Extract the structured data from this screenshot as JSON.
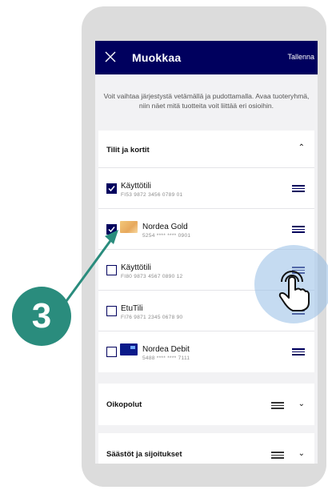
{
  "header": {
    "title": "Muokkaa",
    "save_label": "Tallenna",
    "close_icon": "close-icon"
  },
  "intro_text": "Voit vaihtaa järjestystä vetämällä ja pudottamalla. Avaa tuoteryhmä, niin näet mitä tuotteita voit liittää eri osioihin.",
  "sections": {
    "accounts": {
      "title": "Tilit ja kortit",
      "expanded": true
    },
    "shortcuts": {
      "title": "Oikopolut"
    },
    "savings": {
      "title": "Säästöt ja sijoitukset"
    }
  },
  "items": [
    {
      "name": "Käyttötili",
      "number": "FI53 9872 3456 0789 01",
      "checked": true,
      "thumb": "none"
    },
    {
      "name": "Nordea Gold",
      "number": "5254 **** **** 0901",
      "checked": true,
      "thumb": "gold-card"
    },
    {
      "name": "Käyttötili",
      "number": "FI80 9873 4567 0890 12",
      "checked": false,
      "thumb": "none"
    },
    {
      "name": "EtuTili",
      "number": "FI76 9871 2345 0678 90",
      "checked": false,
      "thumb": "none"
    },
    {
      "name": "Nordea Debit",
      "number": "5488 **** **** 7111",
      "checked": false,
      "thumb": "debit-card"
    }
  ],
  "step_badge": "3",
  "colors": {
    "brand": "#00005e",
    "step": "#2a8c7d",
    "touch": "#96bee6"
  }
}
